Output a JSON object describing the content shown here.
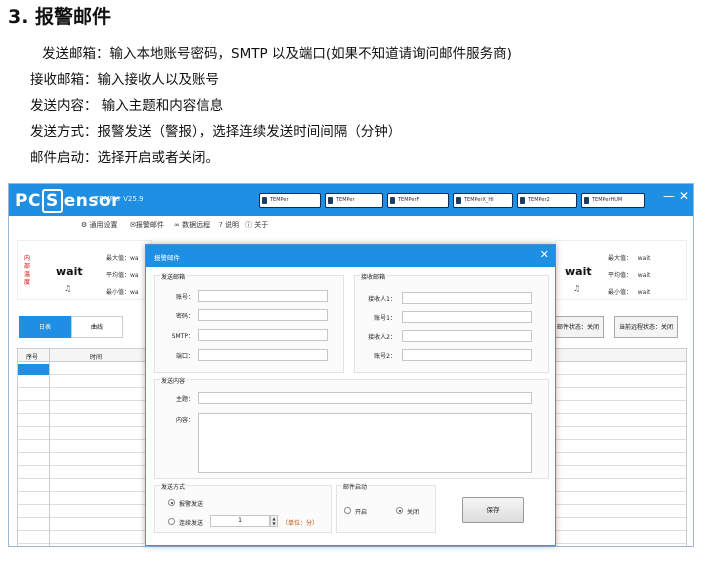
{
  "doc": {
    "heading": "3. 报警邮件",
    "lines": [
      "发送邮箱：输入本地账号密码，SMTP 以及端口(如果不知道请询问邮件服务商)",
      "接收邮箱：输入接收人以及账号",
      "发送内容：  输入主题和内容信息",
      "发送方式：报警发送（警报），选择连续发送时间间隔（分钟）",
      "邮件启动：选择开启或者关闭。"
    ]
  },
  "app": {
    "logo_left": "PC",
    "logo_box": "S",
    "logo_right": "ensor",
    "version": "TEMPer V25.9",
    "devices": [
      "TEMPer",
      "TEMPer",
      "TEMPerF",
      "TEMPerX_HI",
      "TEMPer2",
      "TEMPerHUM"
    ],
    "win_min": "—",
    "win_close": "✕",
    "menu": [
      "通用设置",
      "报警邮件",
      "数据远程",
      "说明",
      "关于"
    ],
    "left_panel": {
      "label": "内部温度",
      "value": "wait",
      "stats": [
        {
          "label": "最大值：",
          "value": "wa"
        },
        {
          "label": "平均值：",
          "value": "wa"
        },
        {
          "label": "最小值：",
          "value": "wa"
        }
      ]
    },
    "right_panel": {
      "value": "wait",
      "stats": [
        {
          "label": "最大值：",
          "value": "wait"
        },
        {
          "label": "平均值：",
          "value": "wait"
        },
        {
          "label": "最小值：",
          "value": "wait"
        }
      ]
    },
    "tabs": [
      "日表",
      "曲线"
    ],
    "status_mail": "邮件状态：关闭",
    "status_remote": "当前远程状态：关闭",
    "columns": [
      "序号",
      "时间"
    ]
  },
  "dialog": {
    "title": "报警邮件",
    "close": "✕",
    "send_group": "发送邮箱",
    "send_fields": [
      {
        "label": "账号：",
        "value": ""
      },
      {
        "label": "密码：",
        "value": ""
      },
      {
        "label": "SMTP：",
        "value": ""
      },
      {
        "label": "端口：",
        "value": ""
      }
    ],
    "recv_group": "接收邮箱",
    "recv_fields": [
      {
        "label": "接收人1：",
        "value": ""
      },
      {
        "label": "账号1：",
        "value": ""
      },
      {
        "label": "接收人2：",
        "value": ""
      },
      {
        "label": "账号2：",
        "value": ""
      }
    ],
    "content_group": "发送内容",
    "subject_label": "主题：",
    "body_label": "内容：",
    "mode_group": "发送方式",
    "mode_alarm": "报警发送",
    "mode_continuous": "连续发送",
    "interval": "1",
    "unit": "（单位：分）",
    "enable_group": "邮件启动",
    "enable_on": "开启",
    "enable_off": "关闭",
    "save": "保存"
  }
}
